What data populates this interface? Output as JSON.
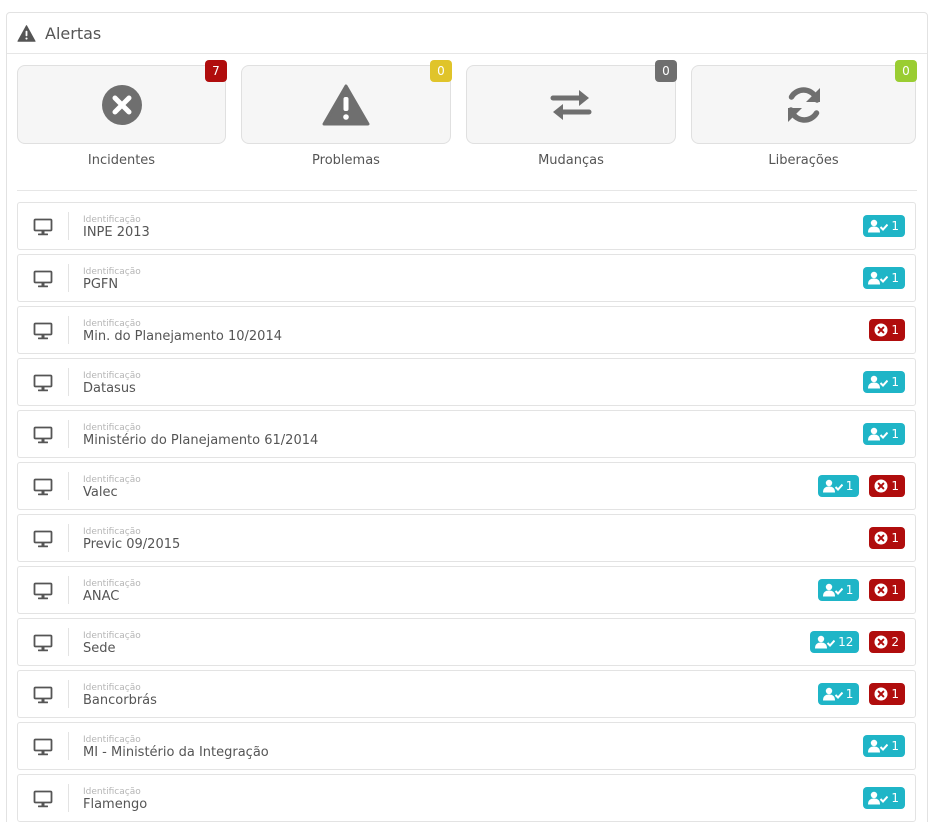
{
  "header": {
    "title": "Alertas",
    "icon": "warning-icon"
  },
  "tiles": [
    {
      "label": "Incidentes",
      "count": "7",
      "icon": "times-circle-icon",
      "badge_color": "#b00d0d"
    },
    {
      "label": "Problemas",
      "count": "0",
      "icon": "warning-icon",
      "badge_color": "#e0c42a"
    },
    {
      "label": "Mudanças",
      "count": "0",
      "icon": "exchange-icon",
      "badge_color": "#6f6f6f"
    },
    {
      "label": "Liberações",
      "count": "0",
      "icon": "refresh-icon",
      "badge_color": "#9acd32"
    }
  ],
  "list": {
    "caption": "Identificação",
    "rows": [
      {
        "name": "INPE 2013",
        "users": "1",
        "incidents": null
      },
      {
        "name": "PGFN",
        "users": "1",
        "incidents": null
      },
      {
        "name": "Min. do Planejamento 10/2014",
        "users": null,
        "incidents": "1"
      },
      {
        "name": "Datasus",
        "users": "1",
        "incidents": null
      },
      {
        "name": "Ministério do Planejamento 61/2014",
        "users": "1",
        "incidents": null
      },
      {
        "name": "Valec",
        "users": "1",
        "incidents": "1"
      },
      {
        "name": "Previc 09/2015",
        "users": null,
        "incidents": "1"
      },
      {
        "name": "ANAC",
        "users": "1",
        "incidents": "1"
      },
      {
        "name": "Sede",
        "users": "12",
        "incidents": "2"
      },
      {
        "name": "Bancorbrás",
        "users": "1",
        "incidents": "1"
      },
      {
        "name": "MI - Ministério da Integração",
        "users": "1",
        "incidents": null
      },
      {
        "name": "Flamengo",
        "users": "1",
        "incidents": null
      }
    ]
  },
  "colors": {
    "user_badge": "#1fb5c7",
    "incident_badge": "#b00d0d",
    "icon_gray": "#6f6f6f"
  }
}
